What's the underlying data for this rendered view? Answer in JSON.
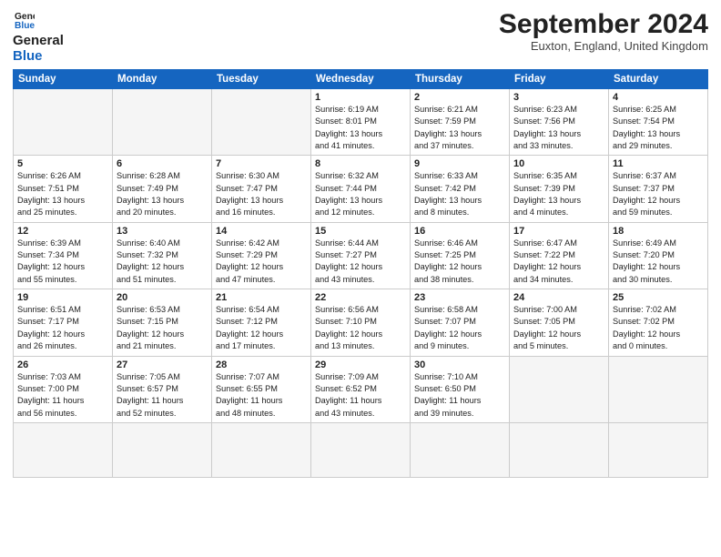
{
  "header": {
    "logo_line1": "General",
    "logo_line2": "Blue",
    "title": "September 2024",
    "subtitle": "Euxton, England, United Kingdom"
  },
  "weekdays": [
    "Sunday",
    "Monday",
    "Tuesday",
    "Wednesday",
    "Thursday",
    "Friday",
    "Saturday"
  ],
  "days": [
    {
      "num": "",
      "info": ""
    },
    {
      "num": "",
      "info": ""
    },
    {
      "num": "",
      "info": ""
    },
    {
      "num": "1",
      "info": "Sunrise: 6:19 AM\nSunset: 8:01 PM\nDaylight: 13 hours\nand 41 minutes."
    },
    {
      "num": "2",
      "info": "Sunrise: 6:21 AM\nSunset: 7:59 PM\nDaylight: 13 hours\nand 37 minutes."
    },
    {
      "num": "3",
      "info": "Sunrise: 6:23 AM\nSunset: 7:56 PM\nDaylight: 13 hours\nand 33 minutes."
    },
    {
      "num": "4",
      "info": "Sunrise: 6:25 AM\nSunset: 7:54 PM\nDaylight: 13 hours\nand 29 minutes."
    },
    {
      "num": "5",
      "info": "Sunrise: 6:26 AM\nSunset: 7:51 PM\nDaylight: 13 hours\nand 25 minutes."
    },
    {
      "num": "6",
      "info": "Sunrise: 6:28 AM\nSunset: 7:49 PM\nDaylight: 13 hours\nand 20 minutes."
    },
    {
      "num": "7",
      "info": "Sunrise: 6:30 AM\nSunset: 7:47 PM\nDaylight: 13 hours\nand 16 minutes."
    },
    {
      "num": "8",
      "info": "Sunrise: 6:32 AM\nSunset: 7:44 PM\nDaylight: 13 hours\nand 12 minutes."
    },
    {
      "num": "9",
      "info": "Sunrise: 6:33 AM\nSunset: 7:42 PM\nDaylight: 13 hours\nand 8 minutes."
    },
    {
      "num": "10",
      "info": "Sunrise: 6:35 AM\nSunset: 7:39 PM\nDaylight: 13 hours\nand 4 minutes."
    },
    {
      "num": "11",
      "info": "Sunrise: 6:37 AM\nSunset: 7:37 PM\nDaylight: 12 hours\nand 59 minutes."
    },
    {
      "num": "12",
      "info": "Sunrise: 6:39 AM\nSunset: 7:34 PM\nDaylight: 12 hours\nand 55 minutes."
    },
    {
      "num": "13",
      "info": "Sunrise: 6:40 AM\nSunset: 7:32 PM\nDaylight: 12 hours\nand 51 minutes."
    },
    {
      "num": "14",
      "info": "Sunrise: 6:42 AM\nSunset: 7:29 PM\nDaylight: 12 hours\nand 47 minutes."
    },
    {
      "num": "15",
      "info": "Sunrise: 6:44 AM\nSunset: 7:27 PM\nDaylight: 12 hours\nand 43 minutes."
    },
    {
      "num": "16",
      "info": "Sunrise: 6:46 AM\nSunset: 7:25 PM\nDaylight: 12 hours\nand 38 minutes."
    },
    {
      "num": "17",
      "info": "Sunrise: 6:47 AM\nSunset: 7:22 PM\nDaylight: 12 hours\nand 34 minutes."
    },
    {
      "num": "18",
      "info": "Sunrise: 6:49 AM\nSunset: 7:20 PM\nDaylight: 12 hours\nand 30 minutes."
    },
    {
      "num": "19",
      "info": "Sunrise: 6:51 AM\nSunset: 7:17 PM\nDaylight: 12 hours\nand 26 minutes."
    },
    {
      "num": "20",
      "info": "Sunrise: 6:53 AM\nSunset: 7:15 PM\nDaylight: 12 hours\nand 21 minutes."
    },
    {
      "num": "21",
      "info": "Sunrise: 6:54 AM\nSunset: 7:12 PM\nDaylight: 12 hours\nand 17 minutes."
    },
    {
      "num": "22",
      "info": "Sunrise: 6:56 AM\nSunset: 7:10 PM\nDaylight: 12 hours\nand 13 minutes."
    },
    {
      "num": "23",
      "info": "Sunrise: 6:58 AM\nSunset: 7:07 PM\nDaylight: 12 hours\nand 9 minutes."
    },
    {
      "num": "24",
      "info": "Sunrise: 7:00 AM\nSunset: 7:05 PM\nDaylight: 12 hours\nand 5 minutes."
    },
    {
      "num": "25",
      "info": "Sunrise: 7:02 AM\nSunset: 7:02 PM\nDaylight: 12 hours\nand 0 minutes."
    },
    {
      "num": "26",
      "info": "Sunrise: 7:03 AM\nSunset: 7:00 PM\nDaylight: 11 hours\nand 56 minutes."
    },
    {
      "num": "27",
      "info": "Sunrise: 7:05 AM\nSunset: 6:57 PM\nDaylight: 11 hours\nand 52 minutes."
    },
    {
      "num": "28",
      "info": "Sunrise: 7:07 AM\nSunset: 6:55 PM\nDaylight: 11 hours\nand 48 minutes."
    },
    {
      "num": "29",
      "info": "Sunrise: 7:09 AM\nSunset: 6:52 PM\nDaylight: 11 hours\nand 43 minutes."
    },
    {
      "num": "30",
      "info": "Sunrise: 7:10 AM\nSunset: 6:50 PM\nDaylight: 11 hours\nand 39 minutes."
    },
    {
      "num": "",
      "info": ""
    },
    {
      "num": "",
      "info": ""
    },
    {
      "num": "",
      "info": ""
    },
    {
      "num": "",
      "info": ""
    },
    {
      "num": "",
      "info": ""
    }
  ]
}
